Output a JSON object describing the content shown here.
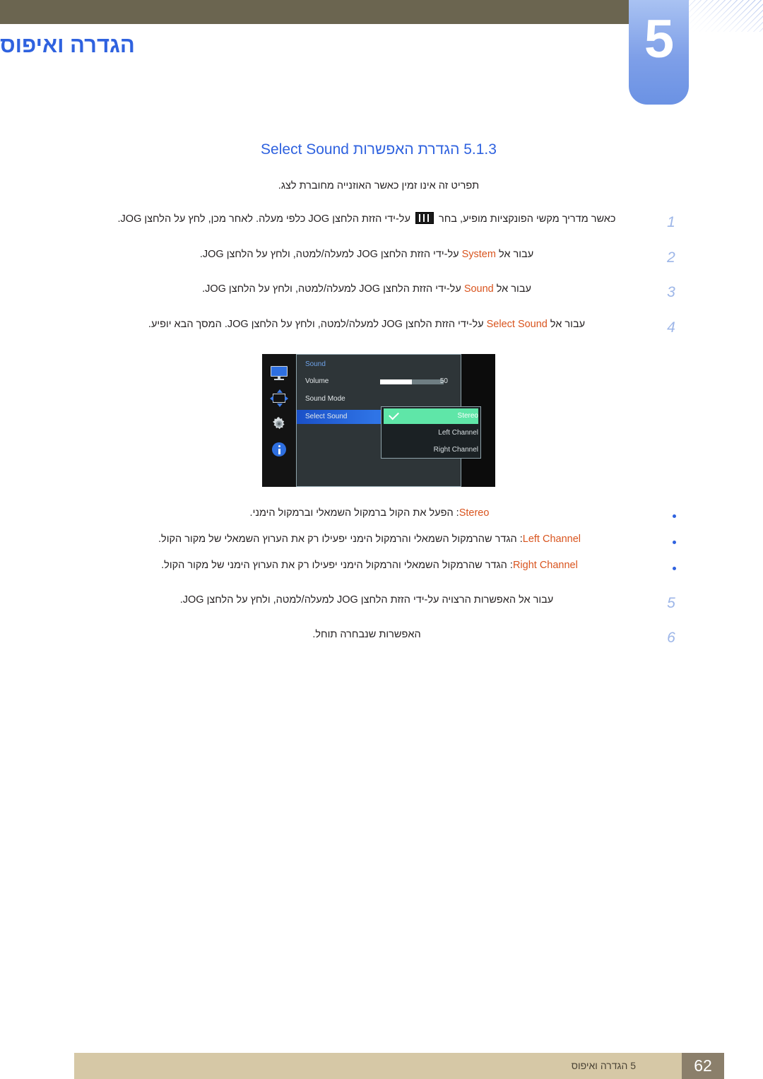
{
  "header": {
    "chapter_number": "5",
    "chapter_title": "הגדרה ואיפוס"
  },
  "section": {
    "heading": "5.1.3 הגדרת האפשרות Select Sound",
    "intro_note": "תפריט זה אינו זמין כאשר האוזנייה מחוברת לצג."
  },
  "steps": [
    {
      "num": "1",
      "text_before_icon": "כאשר מדריך מקשי הפונקציות מופיע, בחר ",
      "icon": "function-key-guide-icon",
      "text_after_icon": " על-ידי הזזת הלחצן JOG כלפי מעלה. לאחר מכן, לחץ על הלחצן JOG."
    },
    {
      "num": "2",
      "text_start": "עבור אל ",
      "highlight": "System",
      "text_end": " על-ידי הזזת הלחצן JOG למעלה/למטה, ולחץ על הלחצן JOG."
    },
    {
      "num": "3",
      "text_start": "עבור אל ",
      "highlight": "Sound",
      "text_end": " על-ידי הזזת הלחצן JOG למעלה/למטה, ולחץ על הלחצן JOG."
    },
    {
      "num": "4",
      "text_start": "עבור אל ",
      "highlight": "Select Sound",
      "text_end": " על-ידי הזזת הלחצן JOG למעלה/למטה, ולחץ על הלחצן JOG. המסך הבא יופיע."
    }
  ],
  "steps_after": [
    {
      "num": "5",
      "text": "עבור אל האפשרות הרצויה על-ידי הזזת הלחצן JOG למעלה/למטה, ולחץ על הלחצן JOG."
    },
    {
      "num": "6",
      "text": "האפשרות שנבחרה תוחל."
    }
  ],
  "osd": {
    "title": "Sound",
    "sidebar_icons": [
      "monitor-icon",
      "picture-position-icon",
      "gear-icon",
      "info-icon"
    ],
    "rows": [
      {
        "label": "Volume",
        "value": "50",
        "slider_percent": 50
      },
      {
        "label": "Sound Mode",
        "value": ""
      },
      {
        "label": "Select Sound",
        "value": "",
        "selected": true
      }
    ],
    "submenu": [
      {
        "label": "Stereo",
        "checked": true
      },
      {
        "label": "Left Channel",
        "checked": false
      },
      {
        "label": "Right Channel",
        "checked": false
      }
    ]
  },
  "bullets": [
    {
      "term": "Stereo",
      "text": ": הפעל את הקול ברמקול השמאלי וברמקול הימני."
    },
    {
      "term": "Left Channel",
      "text": ": הגדר שהרמקול השמאלי והרמקול הימני יפעילו רק את הערוץ השמאלי של מקור הקול."
    },
    {
      "term": "Right Channel",
      "text": ": הגדר שהרמקול השמאלי והרמקול הימני יפעילו רק את הערוץ הימני של מקור הקול."
    }
  ],
  "footer": {
    "text": "5 הגדרה ואיפוס",
    "page_number": "62"
  },
  "colors": {
    "accent_blue": "#2f62df",
    "highlight_orange": "#d9541e",
    "olive_bar": "#6b6550",
    "footer_bg": "#d6c8a6",
    "footer_page_bg": "#8b7f6b",
    "osd_selected_green": "#5fe6a8",
    "osd_selected_blue": "#2f74e6"
  }
}
